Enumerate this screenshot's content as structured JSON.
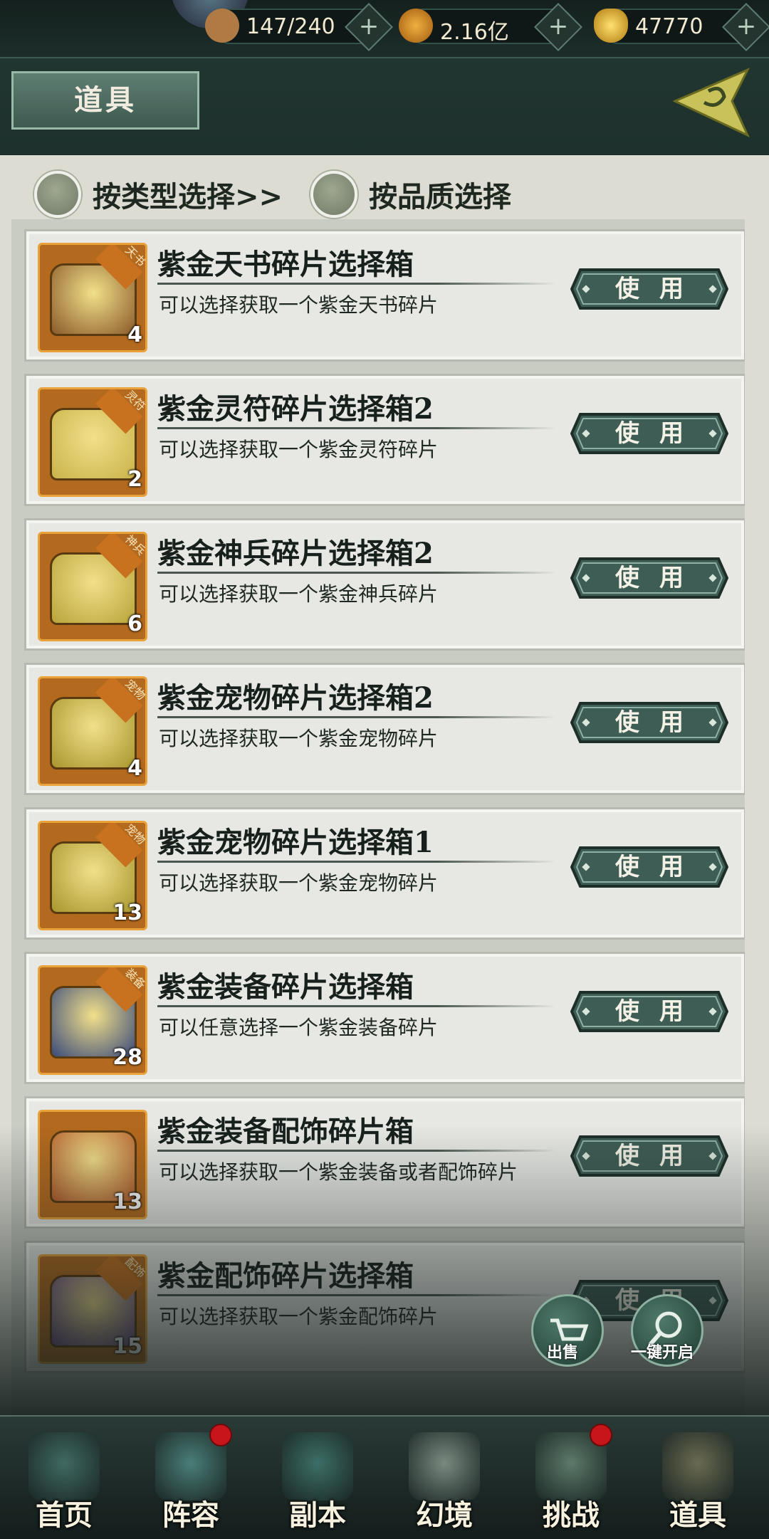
{
  "resources": [
    {
      "name": "stamina",
      "icon": "stamina-pack-icon",
      "value": "147/240",
      "color": "#b07a45"
    },
    {
      "name": "coins",
      "icon": "coin-icon",
      "value": "2.16亿",
      "color": "#d08a20"
    },
    {
      "name": "gold",
      "icon": "gold-ingot-icon",
      "value": "47770",
      "color": "#e0b030"
    }
  ],
  "header": {
    "title": "道具"
  },
  "filters": [
    {
      "label": "按类型选择>>"
    },
    {
      "label": "按品质选择"
    }
  ],
  "use_label": "使用",
  "items": [
    {
      "name": "紫金天书碎片选择箱",
      "desc": "可以选择获取一个紫金天书碎片",
      "count": "4",
      "tag": "天书",
      "chest": "#8a5a2a"
    },
    {
      "name": "紫金灵符碎片选择箱2",
      "desc": "可以选择获取一个紫金灵符碎片",
      "count": "2",
      "tag": "灵符",
      "chest": "#c9b34a"
    },
    {
      "name": "紫金神兵碎片选择箱2",
      "desc": "可以选择获取一个紫金神兵碎片",
      "count": "6",
      "tag": "神兵",
      "chest": "#b9a43a"
    },
    {
      "name": "紫金宠物碎片选择箱2",
      "desc": "可以选择获取一个紫金宠物碎片",
      "count": "4",
      "tag": "宠物",
      "chest": "#a8962e"
    },
    {
      "name": "紫金宠物碎片选择箱1",
      "desc": "可以选择获取一个紫金宠物碎片",
      "count": "13",
      "tag": "宠物",
      "chest": "#a8962e"
    },
    {
      "name": "紫金装备碎片选择箱",
      "desc": "可以任意选择一个紫金装备碎片",
      "count": "28",
      "tag": "装备",
      "chest": "#3a4a7a"
    },
    {
      "name": "紫金装备配饰碎片箱",
      "desc": "可以选择获取一个紫金装备或者配饰碎片",
      "count": "13",
      "tag": "",
      "chest": "#b35a2a"
    },
    {
      "name": "紫金配饰碎片选择箱",
      "desc": "可以选择获取一个紫金配饰碎片",
      "count": "15",
      "tag": "配饰",
      "chest": "#6a4a8a"
    }
  ],
  "float_buttons": [
    {
      "label": "出售",
      "icon": "cart-icon"
    },
    {
      "label": "一键开启",
      "icon": "magnifier-icon"
    }
  ],
  "nav": [
    {
      "label": "首页",
      "icon": "home-pavilion-icon",
      "badge": false
    },
    {
      "label": "阵容",
      "icon": "lineup-book-icon",
      "badge": true
    },
    {
      "label": "副本",
      "icon": "dungeon-sword-icon",
      "badge": false
    },
    {
      "label": "幻境",
      "icon": "crossed-swords-icon",
      "badge": false
    },
    {
      "label": "挑战",
      "icon": "scroll-map-icon",
      "badge": true
    },
    {
      "label": "道具",
      "icon": "item-bag-icon",
      "badge": false
    }
  ]
}
